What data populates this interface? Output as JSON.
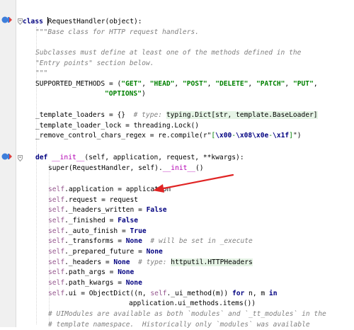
{
  "colors": {
    "keyword": "#000080",
    "string": "#008000",
    "comment": "#808080",
    "self": "#94558d",
    "magic": "#b200b2",
    "arrow": "#e02424",
    "gutter": "#f0f0f0"
  },
  "code": {
    "l1": {
      "kw": "class",
      "name": "RequestHandler",
      "rest": "(object):"
    },
    "l2": {
      "doc": "\"\"\"Base class for HTTP request handlers."
    },
    "l4": {
      "doc": "Subclasses must define at least one of the methods defined in the"
    },
    "l5": {
      "doc": "\"Entry points\" section below."
    },
    "l6": {
      "doc": "\"\"\""
    },
    "l7": {
      "a": "SUPPORTED_METHODS = (",
      "s1": "\"GET\"",
      "s2": "\"HEAD\"",
      "s3": "\"POST\"",
      "s4": "\"DELETE\"",
      "s5": "\"PATCH\"",
      "s6": "\"PUT\"",
      "comma": ", "
    },
    "l8": {
      "s": "\"OPTIONS\"",
      "rest": ")"
    },
    "l10": {
      "a": "_template_loaders = {}  ",
      "c": "# type: ",
      "t": "typing.Dict[str, template.BaseLoader]"
    },
    "l11": {
      "a": "_template_loader_lock = threading.Lock()"
    },
    "l12": {
      "a": "_remove_control_chars_regex = re.compile(r\"",
      "b": "[",
      "e1": "\\x00",
      "d": "-",
      "e2": "\\x08\\x0e",
      "d2": "-",
      "e3": "\\x1f",
      "c": "]",
      "z": "\")"
    },
    "l14": {
      "kw": "def ",
      "name": "__init__",
      "rest": "(self, application, request, **kwargs):"
    },
    "l15": {
      "a": "super(",
      "b": "RequestHandler",
      "c": ", self).",
      "m": "__init__",
      "z": "()"
    },
    "l17": {
      "self": "self",
      "rest": ".application = application"
    },
    "l18": {
      "self": "self",
      "rest": ".request = request"
    },
    "l19": {
      "self": "self",
      "rest": "._headers_written = ",
      "kw": "False"
    },
    "l20": {
      "self": "self",
      "rest": "._finished = ",
      "kw": "False"
    },
    "l21": {
      "self": "self",
      "rest": "._auto_finish = ",
      "kw": "True"
    },
    "l22": {
      "self": "self",
      "rest": "._transforms = ",
      "kw": "None",
      "c": "  # will be set in _execute"
    },
    "l23": {
      "self": "self",
      "rest": "._prepared_future = ",
      "kw": "None"
    },
    "l24": {
      "self": "self",
      "rest": "._headers = ",
      "kw": "None",
      "c": "  # type: ",
      "t": "httputil.HTTPHeaders"
    },
    "l25": {
      "self": "self",
      "rest": ".path_args = ",
      "kw": "None"
    },
    "l26": {
      "self": "self",
      "rest": ".path_kwargs = ",
      "kw": "None"
    },
    "l27": {
      "self": "self",
      "r1": ".ui = ObjectDict((n, ",
      "self2": "self",
      "r2": "._ui_method(m)) ",
      "kw1": "for",
      "r3": " n, m ",
      "kw2": "in"
    },
    "l28": {
      "a": "application.ui_methods.items())"
    },
    "l29": {
      "c": "# UIModules are available as both `modules` and `_tt_modules` in the"
    },
    "l30": {
      "c": "# template namespace.  Historically only `modules` was available"
    }
  }
}
